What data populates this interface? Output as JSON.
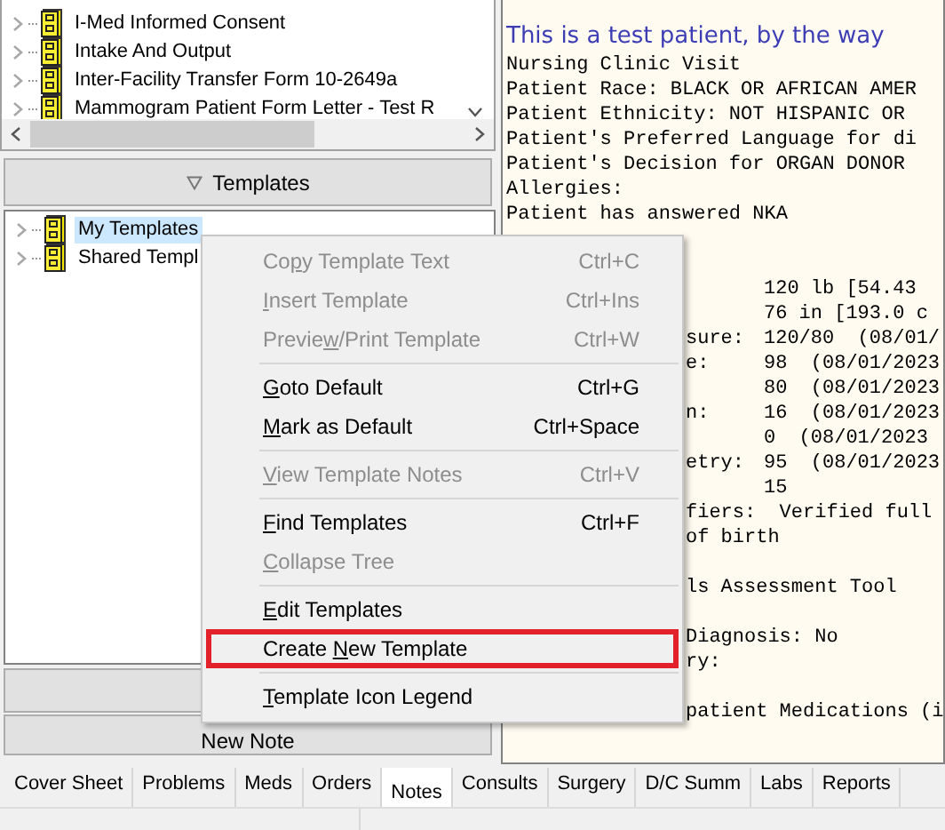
{
  "template_list": {
    "items": [
      {
        "label": "I-Med Informed Consent"
      },
      {
        "label": "Intake And Output"
      },
      {
        "label": "Inter-Facility Transfer Form 10-2649a"
      },
      {
        "label": "Mammogram Patient Form Letter - Test R"
      }
    ]
  },
  "templates_button": {
    "label": "Templates"
  },
  "template_tree": {
    "items": [
      {
        "label": "My Templates",
        "selected": true
      },
      {
        "label": "Shared Templ",
        "selected": false
      }
    ]
  },
  "new_note_button": {
    "label": "New Note"
  },
  "note": {
    "heading": "This is a test patient, by the way",
    "lines": [
      {
        "kind": "full",
        "text": "Nursing Clinic Visit"
      },
      {
        "kind": "full",
        "text": "Patient Race: BLACK OR AFRICAN AMER"
      },
      {
        "kind": "full",
        "text": "Patient Ethnicity: NOT HISPANIC OR"
      },
      {
        "kind": "full",
        "text": "Patient's Preferred Language for di"
      },
      {
        "kind": "full",
        "text": "Patient's Decision for ORGAN DONOR"
      },
      {
        "kind": "full",
        "text": "Allergies:"
      },
      {
        "kind": "full",
        "text": "Patient has answered NKA"
      },
      {
        "kind": "blank"
      },
      {
        "kind": "blank"
      },
      {
        "kind": "tail",
        "value": "120 lb [54.43"
      },
      {
        "kind": "tail",
        "value": "76 in [193.0 c"
      },
      {
        "kind": "tail",
        "label": "sure:",
        "value": "120/80  (08/01/"
      },
      {
        "kind": "tail",
        "label": "e:",
        "value": "98  (08/01/2023"
      },
      {
        "kind": "tail",
        "value": "80  (08/01/2023"
      },
      {
        "kind": "tail",
        "label": "n:",
        "value": "16  (08/01/2023"
      },
      {
        "kind": "tail",
        "value": "0  (08/01/2023"
      },
      {
        "kind": "tail",
        "label": "etry:",
        "value": "95  (08/01/2023"
      },
      {
        "kind": "tail",
        "value": "15"
      },
      {
        "kind": "tail",
        "label": "fiers:  Verified full"
      },
      {
        "kind": "tail",
        "label": "of birth"
      },
      {
        "kind": "blank"
      },
      {
        "kind": "tail",
        "label": "ls Assessment Tool"
      },
      {
        "kind": "blank"
      },
      {
        "kind": "tail",
        "label": "Diagnosis: No"
      },
      {
        "kind": "tail",
        "label": "ry:"
      },
      {
        "kind": "blank"
      },
      {
        "kind": "tail",
        "label": "patient Medications (i"
      }
    ]
  },
  "context_menu": {
    "items": [
      {
        "kind": "item",
        "label": {
          "before": "Co",
          "key": "p",
          "after": "y Template Text"
        },
        "shortcut": "Ctrl+C",
        "disabled": true,
        "highlighted": false
      },
      {
        "kind": "item",
        "label": {
          "key": "I",
          "after": "nsert Template"
        },
        "shortcut": "Ctrl+Ins",
        "disabled": true,
        "highlighted": false
      },
      {
        "kind": "item",
        "label": {
          "before": "Previe",
          "key": "w",
          "after": "/Print Template"
        },
        "shortcut": "Ctrl+W",
        "disabled": true,
        "highlighted": false
      },
      {
        "kind": "separator"
      },
      {
        "kind": "item",
        "label": {
          "key": "G",
          "after": "oto Default"
        },
        "shortcut": "Ctrl+G",
        "disabled": false,
        "highlighted": false
      },
      {
        "kind": "item",
        "label": {
          "key": "M",
          "after": "ark as Default"
        },
        "shortcut": "Ctrl+Space",
        "disabled": false,
        "highlighted": false
      },
      {
        "kind": "separator"
      },
      {
        "kind": "item",
        "label": {
          "key": "V",
          "after": "iew Template Notes"
        },
        "shortcut": "Ctrl+V",
        "disabled": true,
        "highlighted": false
      },
      {
        "kind": "separator"
      },
      {
        "kind": "item",
        "label": {
          "key": "F",
          "after": "ind Templates"
        },
        "shortcut": "Ctrl+F",
        "disabled": false,
        "highlighted": false
      },
      {
        "kind": "item",
        "label": {
          "key": "C",
          "after": "ollapse Tree"
        },
        "disabled": true,
        "highlighted": false
      },
      {
        "kind": "separator"
      },
      {
        "kind": "item",
        "label": {
          "key": "E",
          "after": "dit Templates"
        },
        "disabled": false,
        "highlighted": false
      },
      {
        "kind": "item",
        "label": {
          "before": "Create ",
          "key": "N",
          "after": "ew Template"
        },
        "disabled": false,
        "highlighted": true
      },
      {
        "kind": "separator"
      },
      {
        "kind": "item",
        "label": {
          "key": "T",
          "after": "emplate Icon Legend"
        },
        "disabled": false,
        "highlighted": false
      }
    ]
  },
  "tabs": [
    {
      "label": "Cover Sheet",
      "selected": false
    },
    {
      "label": "Problems",
      "selected": false
    },
    {
      "label": "Meds",
      "selected": false
    },
    {
      "label": "Orders",
      "selected": false
    },
    {
      "label": "Notes",
      "selected": true
    },
    {
      "label": "Consults",
      "selected": false
    },
    {
      "label": "Surgery",
      "selected": false
    },
    {
      "label": "D/C Summ",
      "selected": false
    },
    {
      "label": "Labs",
      "selected": false
    },
    {
      "label": "Reports",
      "selected": false
    }
  ]
}
